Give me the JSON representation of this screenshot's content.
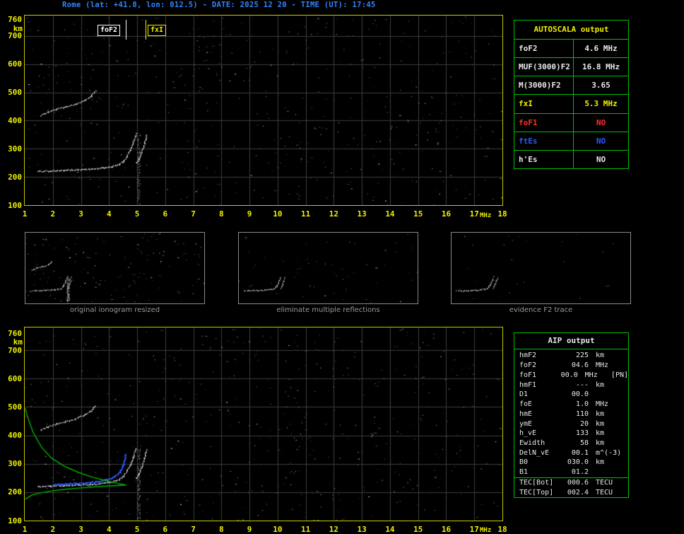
{
  "title": "Rome (lat: +41.8, lon: 012.5) - DATE: 2025 12 20 - TIME (UT): 17:45",
  "colors": {
    "background": "#000000",
    "axis_label": "#f0f000",
    "grid": "#3c3c3c",
    "plot_border": "#c8c800",
    "table_border": "#00c000",
    "title_text": "#2e86ff",
    "trace_white": "#e6e6e6",
    "restored_trace_blue": "#2b59ff",
    "profile_green": "#00b400",
    "caption_gray": "#9a9a9a",
    "no_red": "#ff3030",
    "value_yellow": "#f0f000"
  },
  "top_ionogram": {
    "y_unit": "km",
    "x_unit": "MHz"
  },
  "bottom_ionogram": {
    "y_unit": "km",
    "x_unit": "MHz"
  },
  "autoscala_table": {
    "title": "AUTOSCALA output",
    "rows": [
      {
        "label": "foF2",
        "value": "4.6 MHz",
        "color": "white"
      },
      {
        "label": "MUF(3000)F2",
        "value": "16.8 MHz",
        "color": "white"
      },
      {
        "label": "M(3000)F2",
        "value": "3.65",
        "color": "white"
      },
      {
        "label": "fxI",
        "value": "5.3 MHz",
        "color": "yellow"
      },
      {
        "label": "foF1",
        "value": "NO",
        "color": "red"
      },
      {
        "label": "ftEs",
        "value": "NO",
        "color": "blue"
      },
      {
        "label": "h'Es",
        "value": "NO",
        "color": "white"
      }
    ]
  },
  "aip_table": {
    "title": "AIP output",
    "rows": [
      {
        "name": "hmF2",
        "value": "225",
        "unit": "km",
        "extra": ""
      },
      {
        "name": "foF2",
        "value": "04.6",
        "unit": "MHz",
        "extra": ""
      },
      {
        "name": "foF1",
        "value": "00.0",
        "unit": "MHz",
        "extra": "[PN]"
      },
      {
        "name": "hmF1",
        "value": "---",
        "unit": "km",
        "extra": ""
      },
      {
        "name": "D1",
        "value": "00.0",
        "unit": "",
        "extra": ""
      },
      {
        "name": "foE",
        "value": "1.0",
        "unit": "MHz",
        "extra": ""
      },
      {
        "name": "hmE",
        "value": "110",
        "unit": "km",
        "extra": ""
      },
      {
        "name": "ymE",
        "value": "20",
        "unit": "km",
        "extra": ""
      },
      {
        "name": "h_vE",
        "value": "133",
        "unit": "km",
        "extra": ""
      },
      {
        "name": "Ewidth",
        "value": "58",
        "unit": "km",
        "extra": ""
      },
      {
        "name": "DelN_vE",
        "value": "00.1",
        "unit": "m^(-3)",
        "extra": ""
      },
      {
        "name": "B0",
        "value": "030.0",
        "unit": "km",
        "extra": ""
      },
      {
        "name": "B1",
        "value": "01.2",
        "unit": "",
        "extra": ""
      },
      {
        "name": "TEC[Bot]",
        "value": "000.6",
        "unit": "TECU",
        "extra": "",
        "separator_above": true
      },
      {
        "name": "TEC[Top]",
        "value": "002.4",
        "unit": "TECU",
        "extra": ""
      }
    ]
  },
  "thumbnails": [
    {
      "caption": "original ionogram resized",
      "noise": 150,
      "series": [
        "F2-trace-ordinary",
        "F2-trace-extraordinary",
        "F2-second-hop"
      ],
      "smear": true
    },
    {
      "caption": "eliminate multiple reflections",
      "noise": 60,
      "series": [
        "F2-trace-ordinary",
        "F2-trace-extraordinary"
      ],
      "smear": false
    },
    {
      "caption": "evidence F2 trace",
      "noise": 24,
      "series": [
        "F2-trace-ordinary",
        "F2-trace-extraordinary"
      ],
      "smear": false
    }
  ],
  "chart_data": [
    {
      "type": "scatter",
      "title": "recorded ionogram",
      "xlabel": "MHz",
      "ylabel": "km",
      "xlim": [
        1,
        18
      ],
      "ylim": [
        100,
        760
      ],
      "grid": true,
      "x_ticks": [
        1,
        2,
        3,
        4,
        5,
        6,
        7,
        8,
        9,
        10,
        11,
        12,
        13,
        14,
        15,
        16,
        17,
        18
      ],
      "y_ticks": [
        760,
        700,
        600,
        500,
        400,
        300,
        200,
        100
      ],
      "markers": [
        {
          "label": "foF2",
          "freq_mhz": 4.6,
          "color": "#ffffff",
          "label_side": "left"
        },
        {
          "label": "fxI",
          "freq_mhz": 5.3,
          "color": "#f0f000",
          "label_side": "right"
        }
      ],
      "series": [
        {
          "name": "F2-trace-ordinary",
          "color": "#e6e6e6",
          "style": "dots",
          "x": [
            1.45,
            1.9,
            2.4,
            2.9,
            3.4,
            3.8,
            4.1,
            4.35,
            4.5,
            4.62,
            4.75,
            4.85,
            4.95
          ],
          "y": [
            221,
            223,
            225,
            227,
            229,
            233,
            238,
            246,
            258,
            275,
            298,
            325,
            355
          ]
        },
        {
          "name": "F2-trace-extraordinary",
          "color": "#e6e6e6",
          "style": "dots",
          "x": [
            4.95,
            5.05,
            5.15,
            5.25,
            5.32
          ],
          "y": [
            250,
            265,
            288,
            318,
            350
          ]
        },
        {
          "name": "F2-second-hop",
          "color": "#d8d8d8",
          "style": "dots",
          "x": [
            1.55,
            1.8,
            2.1,
            2.45,
            2.8,
            3.1,
            3.35,
            3.5
          ],
          "y": [
            420,
            431,
            441,
            450,
            460,
            472,
            488,
            505
          ]
        }
      ],
      "cusp_smear": {
        "freq_mhz": 5.05,
        "h0": 355,
        "h1": 105,
        "n": 110
      }
    },
    {
      "type": "scatter",
      "title": "autoscaled ionogram with restored trace and electron density profile",
      "xlabel": "MHz",
      "ylabel": "km",
      "xlim": [
        1,
        18
      ],
      "ylim": [
        100,
        760
      ],
      "grid": true,
      "x_ticks": [
        1,
        2,
        3,
        4,
        5,
        6,
        7,
        8,
        9,
        10,
        11,
        12,
        13,
        14,
        15,
        16,
        17,
        18
      ],
      "y_ticks": [
        760,
        700,
        600,
        500,
        400,
        300,
        200,
        100
      ],
      "annotations": {
        "hmF2_km": 225,
        "foF2_MHz": 4.6
      },
      "series": [
        {
          "name": "F2-trace-ordinary",
          "color": "#e6e6e6",
          "style": "dots",
          "x": [
            1.45,
            1.9,
            2.4,
            2.9,
            3.4,
            3.8,
            4.1,
            4.35,
            4.5,
            4.62,
            4.75,
            4.85,
            4.95
          ],
          "y": [
            221,
            223,
            225,
            227,
            229,
            233,
            238,
            246,
            258,
            275,
            298,
            325,
            355
          ]
        },
        {
          "name": "F2-trace-extraordinary",
          "color": "#e6e6e6",
          "style": "dots",
          "x": [
            4.95,
            5.05,
            5.15,
            5.25,
            5.32
          ],
          "y": [
            250,
            265,
            288,
            318,
            350
          ]
        },
        {
          "name": "F2-second-hop",
          "color": "#d8d8d8",
          "style": "dots",
          "x": [
            1.55,
            1.8,
            2.1,
            2.45,
            2.8,
            3.1,
            3.35,
            3.5
          ],
          "y": [
            420,
            431,
            441,
            450,
            460,
            472,
            488,
            505
          ]
        },
        {
          "name": "restored-F2-trace",
          "color": "#2b59ff",
          "style": "thickdots",
          "x": [
            2.0,
            2.4,
            2.8,
            3.2,
            3.6,
            3.95,
            4.2,
            4.38,
            4.5,
            4.57
          ],
          "y": [
            229,
            231,
            233,
            236,
            240,
            247,
            257,
            273,
            300,
            335
          ]
        },
        {
          "name": "Ne-profile-bottomside",
          "color": "#00b400",
          "style": "line",
          "x": [
            1.02,
            1.25,
            1.6,
            2.0,
            2.5,
            3.0,
            3.5,
            4.0,
            4.4,
            4.6
          ],
          "y": [
            175,
            190,
            198,
            205,
            211,
            215,
            219,
            222,
            224,
            225
          ]
        },
        {
          "name": "Ne-profile-topside",
          "color": "#00b400",
          "style": "line",
          "x": [
            4.6,
            4.3,
            3.9,
            3.4,
            2.9,
            2.4,
            1.95,
            1.6,
            1.3,
            1.1,
            1.02
          ],
          "y": [
            225,
            231,
            240,
            253,
            270,
            292,
            320,
            358,
            410,
            465,
            495
          ]
        }
      ],
      "cusp_smear": {
        "freq_mhz": 5.05,
        "h0": 355,
        "h1": 105,
        "n": 110
      }
    }
  ]
}
